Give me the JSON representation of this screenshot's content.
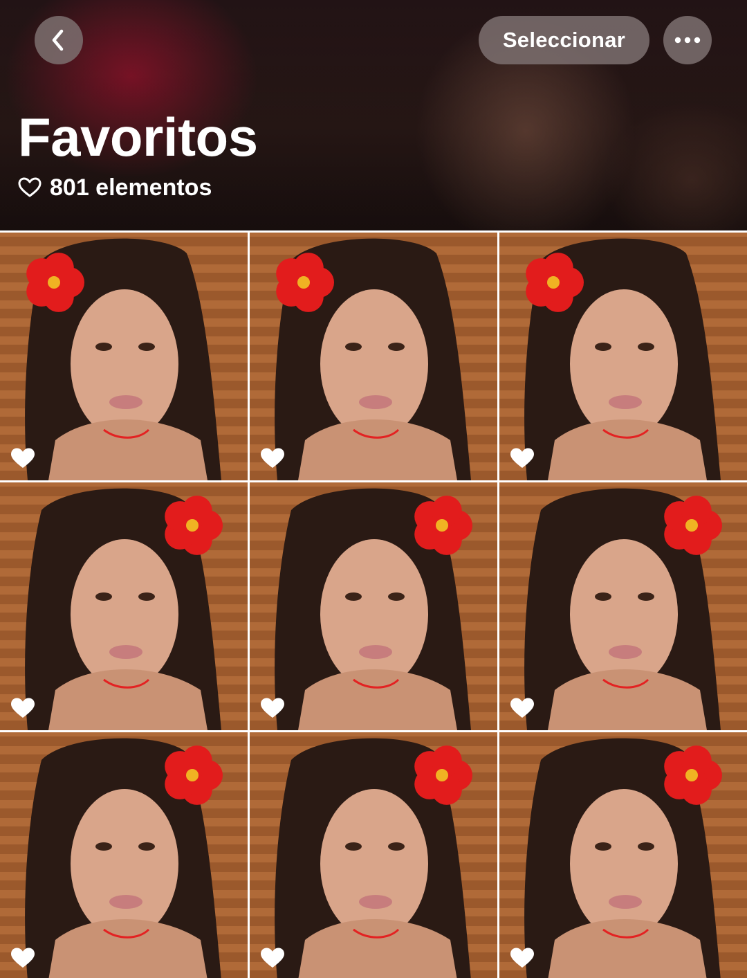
{
  "header": {
    "title": "Favoritos",
    "item_count": "801 elementos",
    "select_label": "Seleccionar",
    "back_icon": "chevron-left-icon",
    "more_icon": "ellipsis-icon",
    "count_icon": "heart-outline-icon"
  },
  "colors": {
    "button_bg": "#7d7070",
    "text": "#ffffff",
    "grid_gap": "#ffffff"
  },
  "photos": [
    {
      "favorite": true,
      "flower": "top-left"
    },
    {
      "favorite": true,
      "flower": "top-left"
    },
    {
      "favorite": true,
      "flower": "top-left"
    },
    {
      "favorite": true,
      "flower": "right"
    },
    {
      "favorite": true,
      "flower": "right"
    },
    {
      "favorite": true,
      "flower": "right"
    },
    {
      "favorite": true,
      "flower": "right"
    },
    {
      "favorite": true,
      "flower": "right"
    },
    {
      "favorite": true,
      "flower": "right"
    }
  ]
}
